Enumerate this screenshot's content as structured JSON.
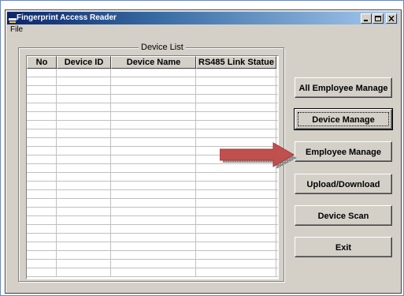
{
  "window": {
    "title": "Fingerprint Access Reader",
    "menu": {
      "file": "File"
    }
  },
  "device_list": {
    "label": "Device List",
    "columns": [
      "No",
      "Device ID",
      "Device Name",
      "RS485 Link Statue"
    ],
    "rows": []
  },
  "buttons": {
    "all_employee_manage": "All Employee Manage",
    "device_manage": "Device Manage",
    "employee_manage": "Employee Manage",
    "upload_download": "Upload/Download",
    "device_scan": "Device Scan",
    "exit": "Exit"
  },
  "colors": {
    "title_bar": "#0a246a",
    "face": "#d4d0c8",
    "arrow": "#c0504d"
  },
  "icons": [
    "app-icon",
    "minimize-icon",
    "maximize-icon",
    "close-icon",
    "arrow-icon"
  ]
}
